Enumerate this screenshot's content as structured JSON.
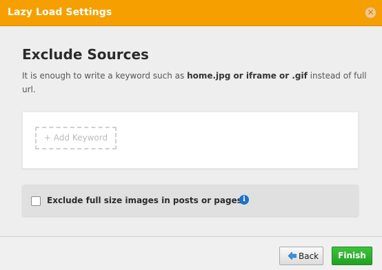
{
  "header": {
    "title": "Lazy Load Settings",
    "close_glyph": "✕",
    "bg_color": "#f5a000"
  },
  "main": {
    "section_title": "Exclude Sources",
    "description": {
      "prefix": "It is enough to write a keyword such as ",
      "examples": "home.jpg or iframe or .gif",
      "suffix": " instead of full url."
    },
    "add_keyword_label": "+ Add Keyword",
    "option": {
      "label": "Exclude full size images in posts or pages",
      "checked": false,
      "info_glyph": "i"
    }
  },
  "footer": {
    "back_label": "Back",
    "finish_label": "Finish",
    "finish_color": "#2eb52e"
  }
}
